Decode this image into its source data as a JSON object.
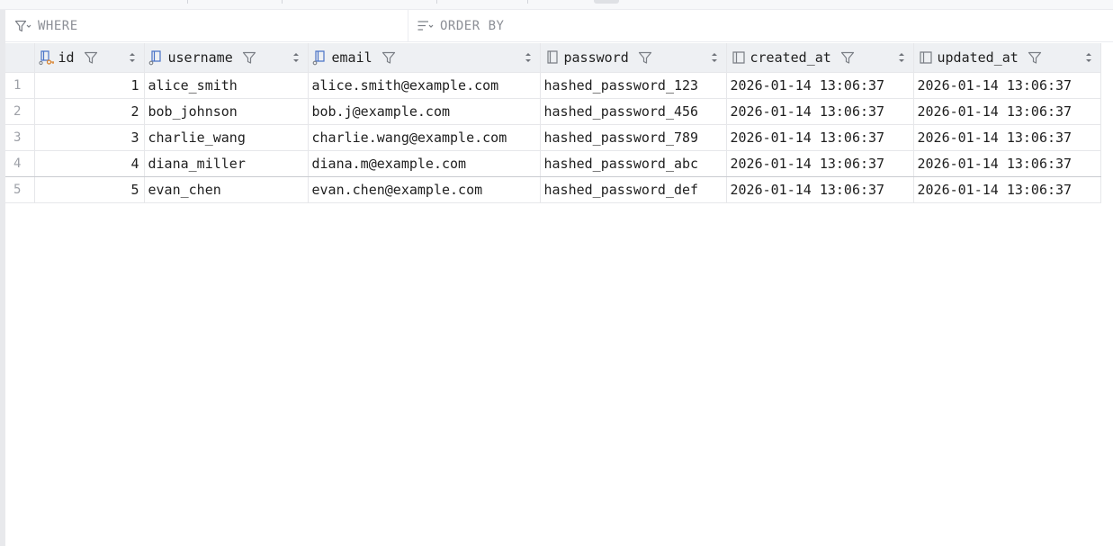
{
  "filters": {
    "where_placeholder": "WHERE",
    "orderby_placeholder": "ORDER BY"
  },
  "table": {
    "columns": [
      {
        "label": "id",
        "icon": "primary-key-column-icon"
      },
      {
        "label": "username",
        "icon": "unique-key-column-icon"
      },
      {
        "label": "email",
        "icon": "unique-key-column-icon"
      },
      {
        "label": "password",
        "icon": "column-icon"
      },
      {
        "label": "created_at",
        "icon": "column-icon"
      },
      {
        "label": "updated_at",
        "icon": "column-icon"
      }
    ],
    "row_numbers": [
      "1",
      "2",
      "3",
      "4",
      "5"
    ],
    "rows": [
      [
        "1",
        "alice_smith",
        "alice.smith@example.com",
        "hashed_password_123",
        "2026-01-14 13:06:37",
        "2026-01-14 13:06:37"
      ],
      [
        "2",
        "bob_johnson",
        "bob.j@example.com",
        "hashed_password_456",
        "2026-01-14 13:06:37",
        "2026-01-14 13:06:37"
      ],
      [
        "3",
        "charlie_wang",
        "charlie.wang@example.com",
        "hashed_password_789",
        "2026-01-14 13:06:37",
        "2026-01-14 13:06:37"
      ],
      [
        "4",
        "diana_miller",
        "diana.m@example.com",
        "hashed_password_abc",
        "2026-01-14 13:06:37",
        "2026-01-14 13:06:37"
      ],
      [
        "5",
        "evan_chen",
        "evan.chen@example.com",
        "hashed_password_def",
        "2026-01-14 13:06:37",
        "2026-01-14 13:06:37"
      ]
    ]
  },
  "colors": {
    "primary_key_accent": "#d9822b",
    "column_icon_blue": "#4a73c7",
    "icon_gray": "#7a7e85"
  }
}
